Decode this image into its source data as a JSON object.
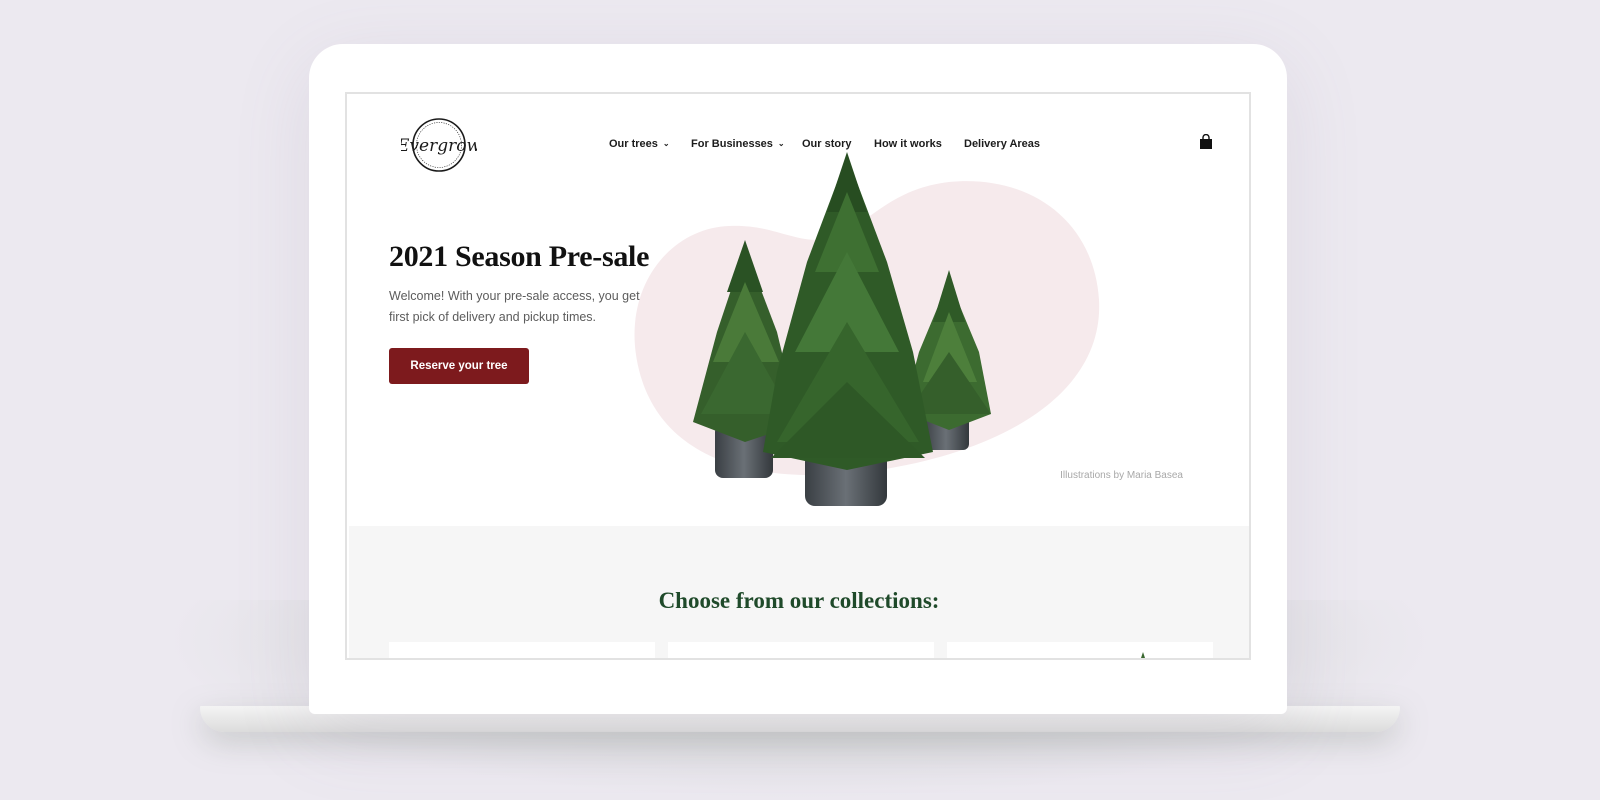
{
  "brand": {
    "name": "Evergrow"
  },
  "nav": {
    "items": [
      {
        "label": "Our trees",
        "has_dropdown": true
      },
      {
        "label": "For Businesses",
        "has_dropdown": true
      },
      {
        "label": "Our story",
        "has_dropdown": false
      },
      {
        "label": "How it works",
        "has_dropdown": false
      },
      {
        "label": "Delivery Areas",
        "has_dropdown": false
      }
    ],
    "cart_icon": "shopping-bag-icon",
    "dropdown_icon": "chevron-down-icon"
  },
  "hero": {
    "title": "2021 Season Pre-sale",
    "text": "Welcome! With your pre-sale access, you get first pick of delivery and pickup times.",
    "cta_label": "Reserve your tree",
    "credit": "Illustrations by Maria Basea"
  },
  "collections": {
    "title": "Choose from our collections:",
    "card_count_visible": 3
  },
  "colors": {
    "background": "#ece9f0",
    "accent": "#7d1a1d",
    "heading_green": "#1f4a2a",
    "blob_pink": "#f6eaec",
    "section_gray": "#f6f6f6"
  }
}
